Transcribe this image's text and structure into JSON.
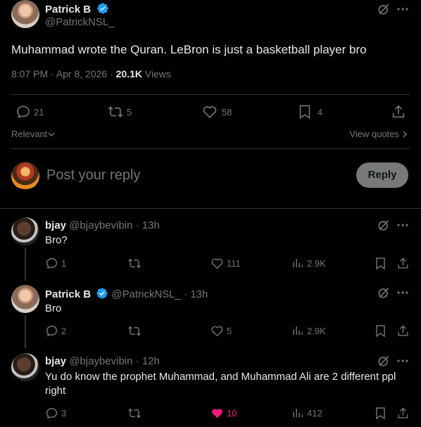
{
  "main_post": {
    "author_name": "Patrick B",
    "author_handle": "@PatrickNSL_",
    "text": "Muhammad wrote the Quran. LeBron is just a basketball player bro",
    "timestamp": "8:07 PM · Apr 8, 2026 · ",
    "views_count": "20.1K",
    "views_label": " Views",
    "replies": "21",
    "reposts": "5",
    "likes": "58",
    "bookmarks": "4"
  },
  "sort": {
    "relevant_label": "Relevant",
    "view_quotes_label": "View quotes"
  },
  "composer": {
    "placeholder": "Post your reply",
    "reply_button": "Reply"
  },
  "replies": [
    {
      "name": "bjay",
      "handle": "@bjaybevibin",
      "time": "13h",
      "text": "Bro?",
      "replies": "1",
      "reposts": "",
      "likes": "111",
      "views": "2.9K",
      "verified": false,
      "liked": false
    },
    {
      "name": "Patrick B",
      "handle": "@PatrickNSL_",
      "time": "13h",
      "text": "Bro",
      "replies": "2",
      "reposts": "",
      "likes": "5",
      "views": "2.9K",
      "verified": true,
      "liked": false
    },
    {
      "name": "bjay",
      "handle": "@bjaybevibin",
      "time": "12h",
      "text": "Yu do know the prophet Muhammad, and Muhammad Ali are 2 different ppl right",
      "replies": "3",
      "reposts": "",
      "likes": "10",
      "views": "412",
      "verified": false,
      "liked": true
    }
  ],
  "colors": {
    "background": "#000000",
    "text": "#e7e9ea",
    "secondary": "#71767b",
    "verified": "#1d9bf0",
    "like_active": "#f91880",
    "reply_button_bg": "#787a7a"
  }
}
